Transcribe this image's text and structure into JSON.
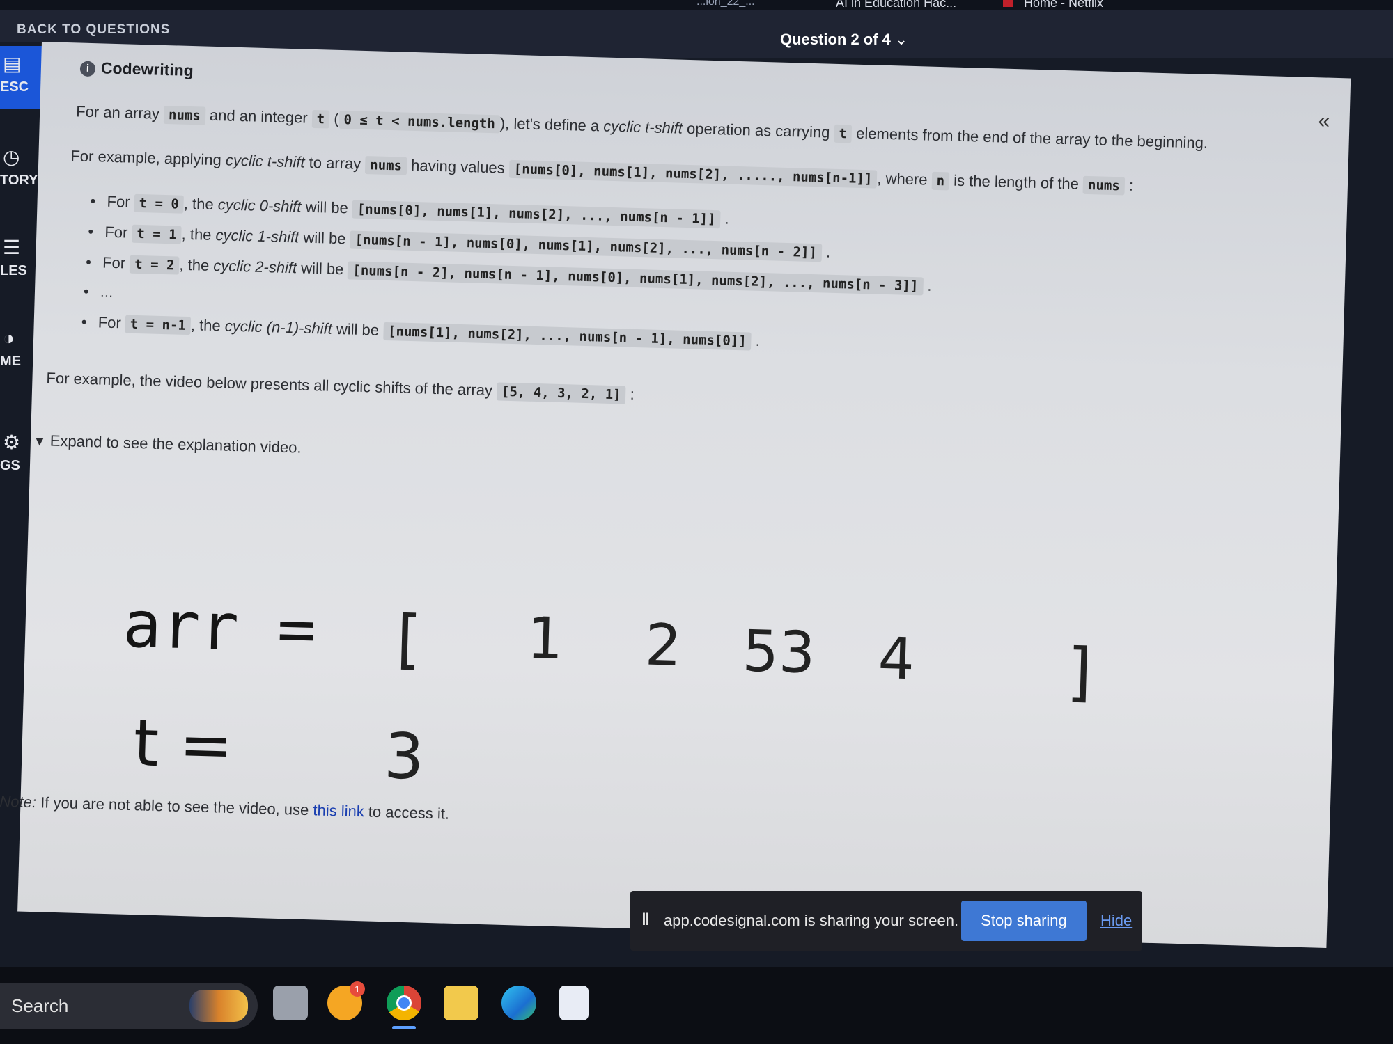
{
  "browser_tabs": [
    "Home - Netflix",
    "AI in Education Hac...",
    "...ion_22_..."
  ],
  "header": {
    "back_label": "BACK TO QUESTIONS",
    "question_nav": "Question 2 of 4",
    "question_nav_chevron": "chevron-down-icon"
  },
  "rail": [
    {
      "label": "ESC",
      "icon": "document-icon"
    },
    {
      "label": "TORY",
      "icon": "clock-icon"
    },
    {
      "label": "LES",
      "icon": "list-icon"
    },
    {
      "label": "ME",
      "icon": "theme-icon"
    },
    {
      "label": "GS",
      "icon": "settings-icon"
    }
  ],
  "panel": {
    "title": "Codewriting",
    "collapse_icon": "«",
    "p1": {
      "a": "For an array",
      "nums": "nums",
      "b": "and an integer",
      "t": "t",
      "cond": "0 ≤ t < nums.length",
      "c": "), let's define a",
      "op": "cyclic t-shift",
      "d": "operation as carrying",
      "t2": "t",
      "e": "elements from the end of the array to the beginning."
    },
    "p2": {
      "a": "For example, applying",
      "op": "cyclic t-shift",
      "b": "to array",
      "nums": "nums",
      "c": "having values",
      "values": "[nums[0], nums[1], nums[2], ....., nums[n-1]]",
      "d": ", where",
      "n": "n",
      "e": "is the length of the",
      "nums2": "nums"
    },
    "bullets": [
      {
        "for": "For",
        "code": "t = 0",
        "mid": ", the",
        "op": "cyclic 0-shift",
        "will": "will be",
        "val": "[nums[0], nums[1], nums[2], ..., nums[n - 1]]"
      },
      {
        "for": "For",
        "code": "t = 1",
        "mid": ", the",
        "op": "cyclic 1-shift",
        "will": "will be",
        "val": "[nums[n - 1], nums[0], nums[1], nums[2], ..., nums[n - 2]]"
      },
      {
        "for": "For",
        "code": "t = 2",
        "mid": ", the",
        "op": "cyclic 2-shift",
        "will": "will be",
        "val": "[nums[n - 2], nums[n - 1], nums[0], nums[1], nums[2], ..., nums[n - 3]]"
      },
      {
        "ellipsis": "..."
      },
      {
        "for": "For",
        "code": "t = n-1",
        "mid": ", the",
        "op": "cyclic (n-1)-shift",
        "will": "will be",
        "val": "[nums[1], nums[2], ..., nums[n - 1], nums[0]]"
      }
    ],
    "p3": {
      "a": "For example, the video below presents all cyclic shifts of the array",
      "arr": "[5, 4, 3, 2, 1]"
    },
    "expand": "Expand to see the explanation video.",
    "video": {
      "arr_label": "arr =",
      "open": "[",
      "close": "]",
      "nums": [
        "1",
        "2",
        "53",
        "4"
      ],
      "t_label": "t =",
      "t_value": "3"
    },
    "note": {
      "label": "Note:",
      "a": "If you are not able to see the video, use",
      "link": "this link",
      "b": "to access it."
    }
  },
  "sharebar": {
    "message": "app.codesignal.com is sharing your screen.",
    "stop": "Stop sharing",
    "hide": "Hide"
  },
  "taskbar": {
    "search": "Search",
    "weather_badge": "1"
  }
}
